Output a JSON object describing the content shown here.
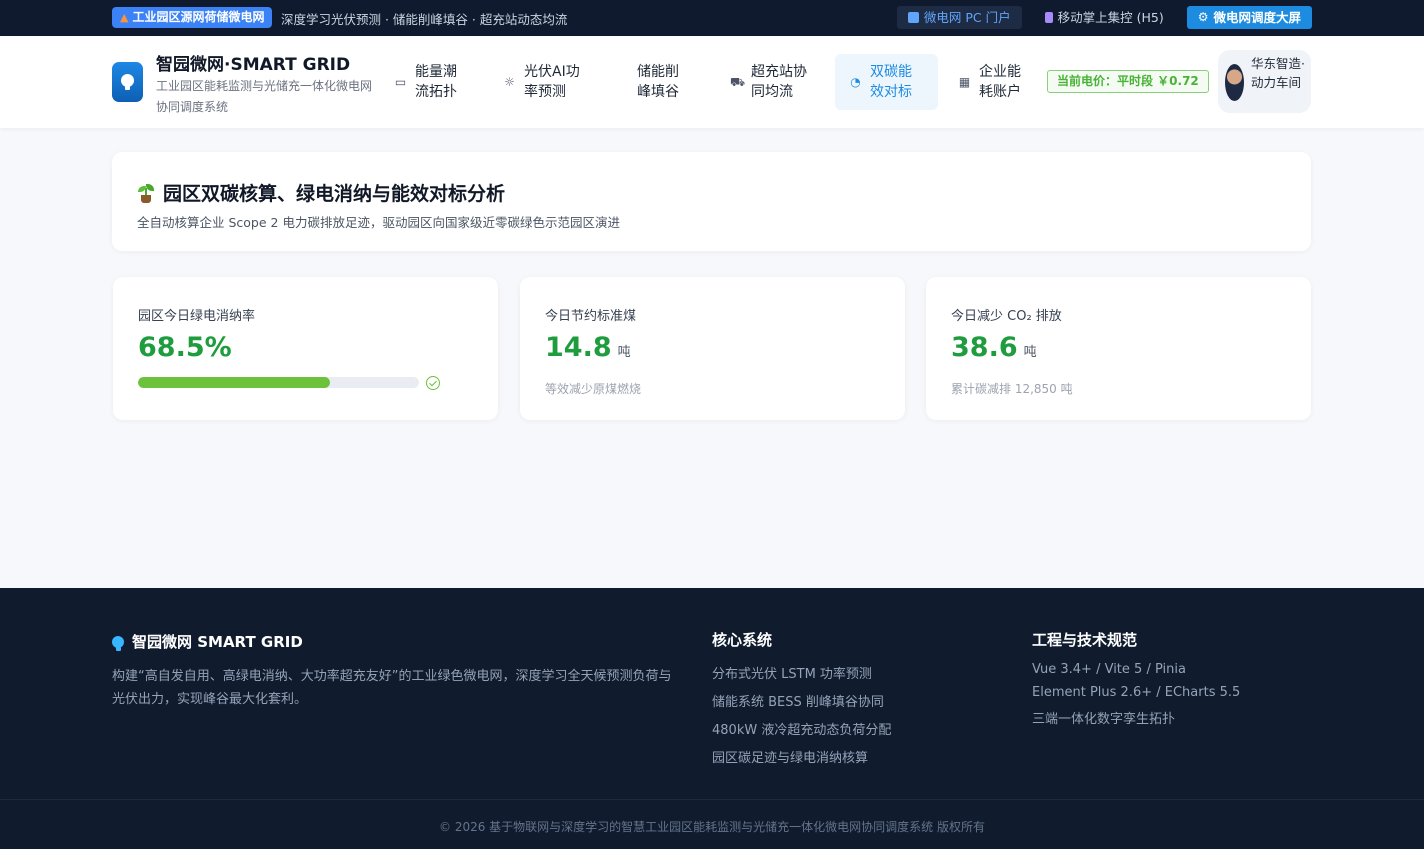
{
  "topbar": {
    "badge": "工业园区源网荷储微电网",
    "tagline": "深度学习光伏预测 · 储能削峰填谷 · 超充站动态均流",
    "links": {
      "pc": "微电网 PC 门户",
      "h5": "移动掌上集控 (H5)",
      "screen": "微电网调度大屏"
    }
  },
  "header": {
    "brand_title": "智园微网·SMART GRID",
    "brand_subtitle": "工业园区能耗监测与光储充一体化微电网协同调度系统",
    "nav": [
      {
        "label": "能量潮流拓扑",
        "icon": "monitor-icon"
      },
      {
        "label": "光伏AI功率预测",
        "icon": "sun-icon"
      },
      {
        "label": "储能削峰填谷",
        "icon": ""
      },
      {
        "label": "超充站协同均流",
        "icon": "truck-icon"
      },
      {
        "label": "双碳能效对标",
        "icon": "pie-chart-icon",
        "active": true
      },
      {
        "label": "企业能耗账户",
        "icon": "building-icon"
      }
    ],
    "price": "当前电价：平时段 ￥0.72",
    "user": "华东智造·动力车间"
  },
  "hero": {
    "title": "园区双碳核算、绿电消纳与能效对标分析",
    "subtitle": "全自动核算企业 Scope 2 电力碳排放足迹，驱动园区向国家级近零碳绿色示范园区演进"
  },
  "stats": {
    "green": {
      "label": "园区今日绿电消纳率",
      "value": "68.5%",
      "progress": 0.685
    },
    "coal": {
      "label": "今日节约标准煤",
      "value": "14.8",
      "unit": "吨",
      "note": "等效减少原煤燃烧"
    },
    "co2": {
      "label": "今日减少 CO₂ 排放",
      "value": "38.6",
      "unit": "吨",
      "note": "累计碳减排 12,850 吨"
    }
  },
  "footer": {
    "brand": "智园微网 SMART GRID",
    "desc": "构建“高自发自用、高绿电消纳、大功率超充友好”的工业绿色微电网，深度学习全天候预测负荷与光伏出力，实现峰谷最大化套利。",
    "core_title": "核心系统",
    "core": [
      "分布式光伏 LSTM 功率预测",
      "储能系统 BESS 削峰填谷协同",
      "480kW 液冷超充动态负荷分配",
      "园区碳足迹与绿电消纳核算"
    ],
    "tech_title": "工程与技术规范",
    "tech": [
      "Vue 3.4+ / Vite 5 / Pinia",
      "Element Plus 2.6+ / ECharts 5.5",
      "三端一体化数字孪生拓扑"
    ],
    "copyright": "© 2026 基于物联网与深度学习的智慧工业园区能耗监测与光储充一体化微电网协同调度系统 版权所有"
  },
  "colors": {
    "accent": "#1d8ce0",
    "green": "#1f9d3e",
    "progress": "#6cc23a",
    "dark": "#0f1a2e"
  }
}
